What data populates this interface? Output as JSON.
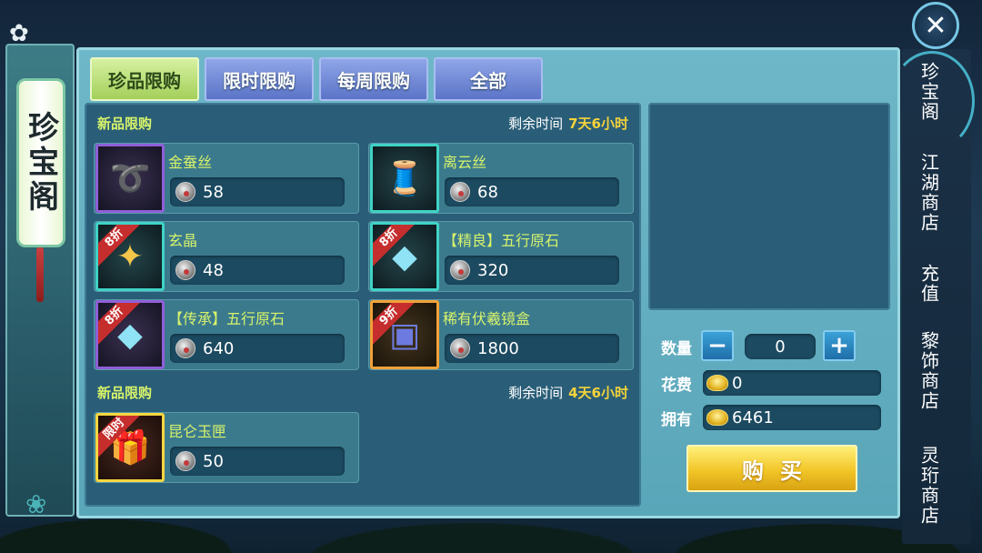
{
  "left_banner": {
    "title": "珍宝阁"
  },
  "tabs": [
    {
      "label": "珍品限购",
      "active": true
    },
    {
      "label": "限时限购",
      "active": false
    },
    {
      "label": "每周限购",
      "active": false
    },
    {
      "label": "全部",
      "active": false
    }
  ],
  "sections": [
    {
      "title": "新品限购",
      "time_label": "剩余时间",
      "time_value": "7天6小时",
      "items": [
        {
          "name": "金蚕丝",
          "tag": "",
          "price": "58",
          "badge": "",
          "icon": "golden-silk-icon"
        },
        {
          "name": "离云丝",
          "tag": "",
          "price": "68",
          "badge": "",
          "icon": "green-silk-spool-icon"
        },
        {
          "name": "玄晶",
          "tag": "",
          "price": "48",
          "badge": "8折",
          "icon": "golden-crystal-icon"
        },
        {
          "name": "五行原石",
          "tag": "【精良】",
          "price": "320",
          "badge": "8折",
          "icon": "blue-gem-icon"
        },
        {
          "name": "五行原石",
          "tag": "【传承】",
          "price": "640",
          "badge": "8折",
          "icon": "blue-gem-icon"
        },
        {
          "name": "稀有伏羲镜盒",
          "tag": "",
          "price": "1800",
          "badge": "9折",
          "icon": "mirror-box-icon"
        }
      ]
    },
    {
      "title": "新品限购",
      "time_label": "剩余时间",
      "time_value": "4天6小时",
      "items": [
        {
          "name": "昆仑玉匣",
          "tag": "",
          "price": "50",
          "badge": "限时",
          "icon": "gift-box-icon"
        }
      ]
    }
  ],
  "purchase": {
    "qty_label": "数量",
    "qty_value": "0",
    "minus": "−",
    "plus": "+",
    "cost_label": "花费",
    "cost_value": "0",
    "own_label": "拥有",
    "own_value": "6461",
    "buy_label": "购买"
  },
  "right_nav": [
    {
      "label": "珍宝阁",
      "active": true
    },
    {
      "label": "江湖商店",
      "active": false
    },
    {
      "label": "充值",
      "active": false
    },
    {
      "label": "黎饰商店",
      "active": false
    },
    {
      "label": "灵珩商店",
      "active": false
    }
  ],
  "close": {
    "glyph": "✕"
  }
}
